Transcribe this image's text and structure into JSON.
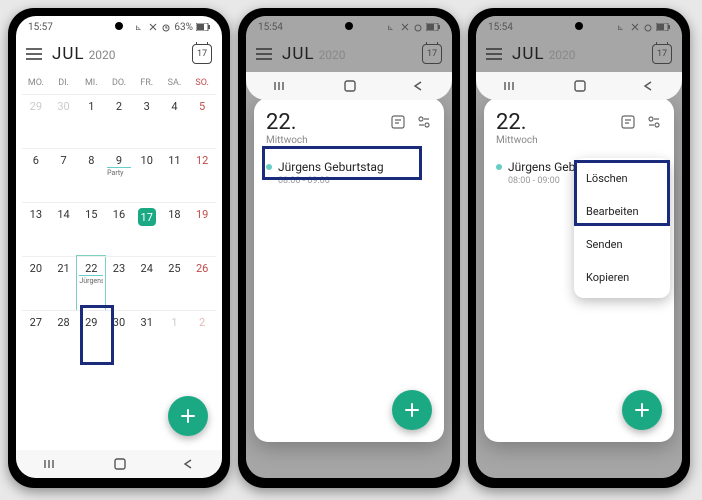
{
  "status": {
    "time_a": "15:57",
    "time_b": "15:54",
    "time_c": "15:54",
    "battery": "63%"
  },
  "header": {
    "month": "JUL",
    "year": "2020",
    "today_num": "17"
  },
  "weekdays": [
    "MO.",
    "DI.",
    "MI.",
    "DO.",
    "FR.",
    "SA.",
    "SO."
  ],
  "calendar": {
    "rows": [
      [
        {
          "n": "29",
          "other": true
        },
        {
          "n": "30",
          "other": true
        },
        {
          "n": "1"
        },
        {
          "n": "2"
        },
        {
          "n": "3"
        },
        {
          "n": "4"
        },
        {
          "n": "5",
          "sun": true
        }
      ],
      [
        {
          "n": "6"
        },
        {
          "n": "7"
        },
        {
          "n": "8"
        },
        {
          "n": "9",
          "ev": "Party"
        },
        {
          "n": "10"
        },
        {
          "n": "11"
        },
        {
          "n": "12",
          "sun": true
        }
      ],
      [
        {
          "n": "13"
        },
        {
          "n": "14"
        },
        {
          "n": "15"
        },
        {
          "n": "16"
        },
        {
          "n": "17",
          "today": true
        },
        {
          "n": "18"
        },
        {
          "n": "19",
          "sun": true
        }
      ],
      [
        {
          "n": "20"
        },
        {
          "n": "21"
        },
        {
          "n": "22",
          "sel": true,
          "ev": "Jürgens Ge"
        },
        {
          "n": "23"
        },
        {
          "n": "24"
        },
        {
          "n": "25"
        },
        {
          "n": "26",
          "sun": true
        }
      ],
      [
        {
          "n": "27"
        },
        {
          "n": "28"
        },
        {
          "n": "29"
        },
        {
          "n": "30"
        },
        {
          "n": "31"
        },
        {
          "n": "1",
          "other": true
        },
        {
          "n": "2",
          "other": true,
          "sun": true
        }
      ]
    ]
  },
  "sheet": {
    "date": "22.",
    "dow": "Mittwoch",
    "event": {
      "title": "Jürgens Geburtstag",
      "time": "08:00 - 09:00"
    }
  },
  "context_menu": {
    "items": [
      "Löschen",
      "Bearbeiten",
      "Senden",
      "Kopieren"
    ]
  }
}
